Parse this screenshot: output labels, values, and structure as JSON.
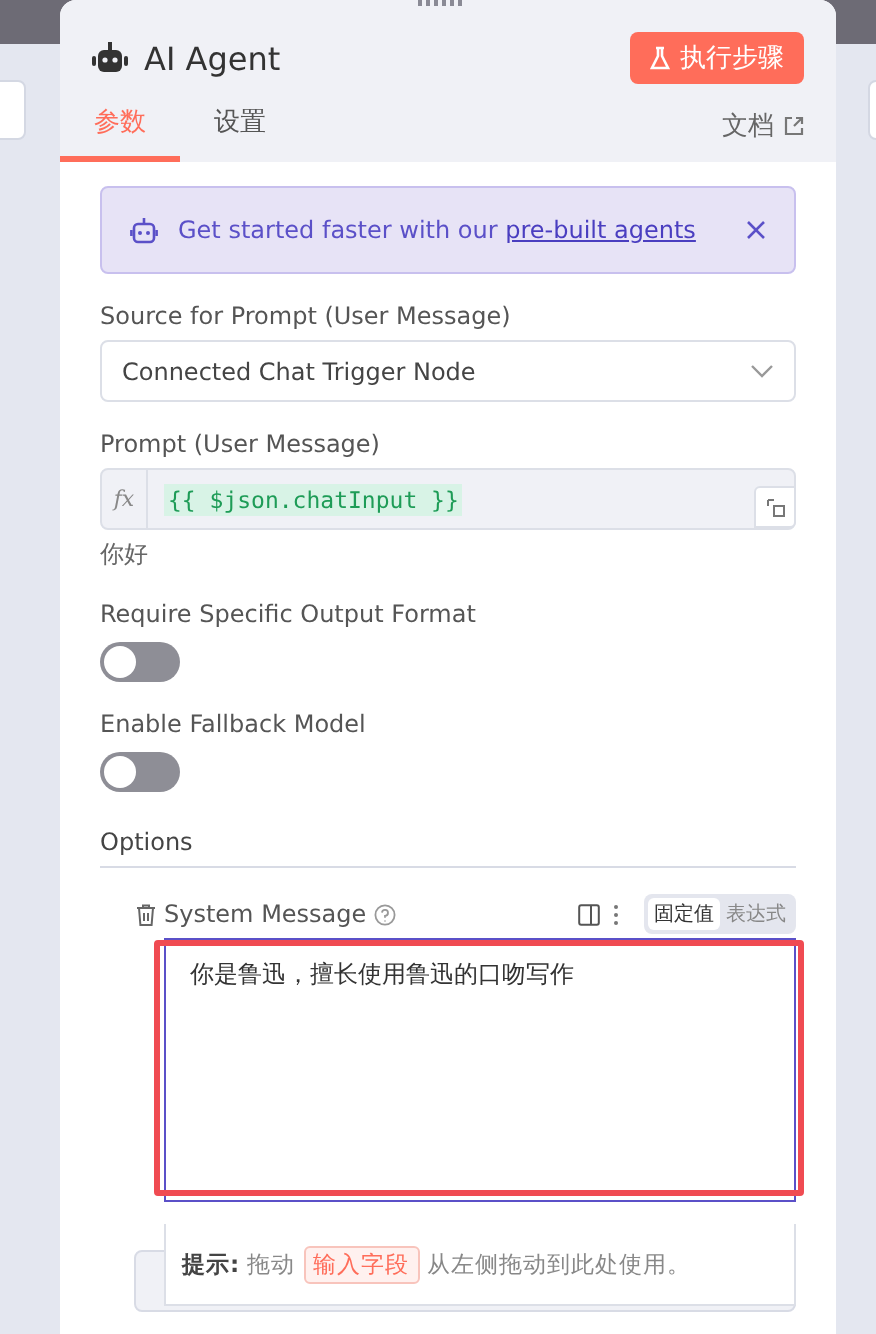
{
  "panel": {
    "title": "AI Agent",
    "run_button": "执行步骤",
    "tabs": [
      {
        "label": "参数",
        "selected": true
      },
      {
        "label": "设置",
        "selected": false
      }
    ],
    "docs_link": "文档"
  },
  "banner": {
    "text": "Get started faster with our ",
    "link": "pre-built agents"
  },
  "fields": [
    {
      "kind": "select",
      "label": "Source for Prompt (User Message)",
      "value": "Connected Chat Trigger Node"
    },
    {
      "kind": "expression",
      "label": "Prompt (User Message)",
      "value": "{{ $json.chatInput }}",
      "prefix": "fx",
      "preview": "你好"
    },
    {
      "kind": "toggle",
      "label": "Require Specific Output Format",
      "on": false
    },
    {
      "kind": "toggle",
      "label": "Enable Fallback Model",
      "on": false
    }
  ],
  "options": {
    "title": "Options",
    "items": [
      {
        "label": "System Message",
        "modes": [
          {
            "label": "固定值",
            "selected": true
          },
          {
            "label": "表达式",
            "selected": false
          }
        ],
        "value": "你是鲁迅，擅长使用鲁迅的口吻写作",
        "highlighted": true
      }
    ]
  },
  "tip": {
    "label": "提示:",
    "before": "拖动",
    "chip": "输入字段",
    "after": "从左侧拖动到此处使用。"
  }
}
